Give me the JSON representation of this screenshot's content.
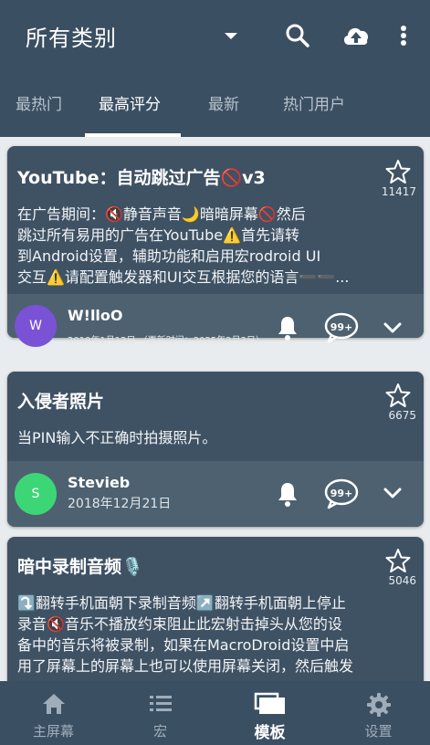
{
  "header": {
    "title": "所有类别",
    "icons": [
      "chevron-down-icon",
      "search-icon",
      "cloud-upload-icon",
      "more-vert-icon"
    ]
  },
  "tabs": [
    {
      "label": "最热门",
      "active": false
    },
    {
      "label": "最高评分",
      "active": true
    },
    {
      "label": "最新",
      "active": false
    },
    {
      "label": "热门用户",
      "active": false
    }
  ],
  "cards": [
    {
      "title": "YouTube：自动跳过广告🚫v3",
      "star_count": "11417",
      "description_lines": [
        "在广告期间：🔇静音声音🌙暗暗屏幕🚫然后",
        "跳过所有易用的广告在YouTube⚠️首先请转",
        "到Android设置，辅助功能和启用宏rodroid UI",
        "交互⚠️请配置触发器和UI交互根据您的语言➖➖..."
      ],
      "author": "W!lloO",
      "avatar_letter": "W",
      "avatar_color": "#7a52d6",
      "date": "2019年1月12日 （更新时间：2025年2月3日）",
      "comment_badge": "99+"
    },
    {
      "title": "入侵者照片",
      "star_count": "6675",
      "description_lines": [
        "当PIN输入不正确时拍摄照片。"
      ],
      "author": "Stevieb",
      "avatar_letter": "S",
      "avatar_color": "#3dd677",
      "date": "2018年12月21日",
      "comment_badge": "99+"
    },
    {
      "title": "暗中录制音频🎙️",
      "star_count": "5046",
      "description_lines": [
        "⤵️翻转手机面朝下录制音频↗️翻转手机面朝上停止",
        "录音🔇音乐不播放约束阻止此宏射击掉头从您的设",
        "备中的音乐将被录制，如果在MacroDroid设置中启",
        "用了屏幕上的屏幕上也可以使用屏幕关闭，然后触发"
      ]
    }
  ],
  "bottom_nav": [
    {
      "label": "主屏幕",
      "icon": "home-icon",
      "active": false
    },
    {
      "label": "宏",
      "icon": "list-icon",
      "active": false
    },
    {
      "label": "模板",
      "icon": "templates-icon",
      "active": true
    },
    {
      "label": "设置",
      "icon": "gear-icon",
      "active": false
    }
  ],
  "colors": {
    "appbar": "#3b4f62",
    "card": "#3f5264",
    "card_footer": "#4d6170",
    "background": "#e9ecee"
  }
}
